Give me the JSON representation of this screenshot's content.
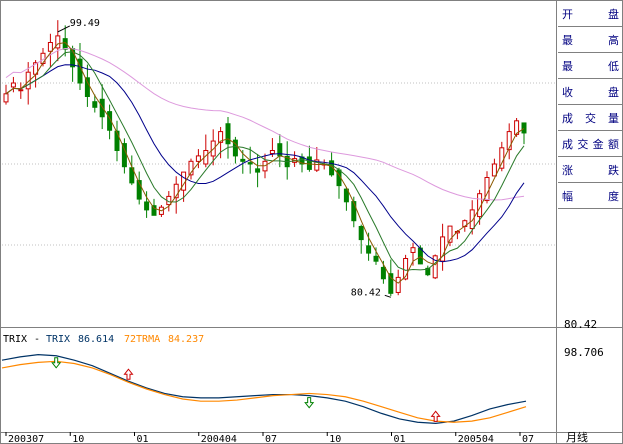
{
  "colors": {
    "background": "#ffffff",
    "up_candle": "#cc0000",
    "down_candle": "#008000",
    "ma_short": "#8b5a00",
    "ma_mid": "#2a7a2a",
    "ma_long": "#00008b",
    "ma_longest": "#dd99dd",
    "trix_line": "#003366",
    "trma_line": "#ff8800",
    "grid": "#c0c0c0",
    "label_blue": "#000080"
  },
  "side_panel": {
    "items": [
      "开盘",
      "最高",
      "最低",
      "收盘",
      "成交量",
      "成交金额",
      "涨跌",
      "幅度"
    ]
  },
  "indicator_header": {
    "name": "TRIX",
    "separator": "-",
    "trix_label": "TRIX",
    "trix_value": "86.614",
    "trma_label": "72TRMA",
    "trma_value": "84.237"
  },
  "price_axis": {
    "bottom_label": "80.42"
  },
  "indicator_axis": {
    "top_label": "98.706"
  },
  "period_label": "月线",
  "chart_data": [
    {
      "type": "candlestick",
      "title": "",
      "x_tick_labels": [
        "200307",
        "10",
        "01",
        "200404",
        "07",
        "10",
        "01",
        "200504",
        "07"
      ],
      "ylim": [
        78,
        102
      ],
      "annotations": {
        "max": {
          "value": 99.49,
          "label": "99.49"
        },
        "min": {
          "value": 80.42,
          "label": "80.42"
        }
      },
      "series": [
        {
          "name": "price",
          "values": [
            95.2,
            96.0,
            95.5,
            96.8,
            97.5,
            98.2,
            99.0,
            99.49,
            98.5,
            97.2,
            96.0,
            95.0,
            94.2,
            93.5,
            92.5,
            91.0,
            89.8,
            88.6,
            87.4,
            86.6,
            86.2,
            86.8,
            87.6,
            88.5,
            89.4,
            90.2,
            90.6,
            91.0,
            91.7,
            92.4,
            91.5,
            90.6,
            90.2,
            90.0,
            89.4,
            90.2,
            91.0,
            90.6,
            89.8,
            90.4,
            90.0,
            89.6,
            90.3,
            90.0,
            89.2,
            88.4,
            87.2,
            85.8,
            84.4,
            83.4,
            82.8,
            81.5,
            80.42,
            81.6,
            83.0,
            83.8,
            82.6,
            81.8,
            83.2,
            84.6,
            85.4,
            85.0,
            85.8,
            86.6,
            87.8,
            89.0,
            90.0,
            91.2,
            92.4,
            93.2,
            92.3
          ]
        }
      ]
    },
    {
      "type": "line",
      "title": "TRIX",
      "series": [
        {
          "name": "TRIX",
          "values": [
            98.2,
            98.5,
            98.7,
            98.6,
            98.2,
            97.7,
            97.0,
            96.3,
            95.7,
            95.2,
            94.9,
            94.8,
            94.8,
            94.9,
            95.0,
            95.1,
            95.1,
            95.0,
            94.8,
            94.5,
            94.0,
            93.4,
            92.9,
            92.6,
            92.5,
            92.7,
            93.2,
            93.8,
            94.2,
            94.5
          ]
        },
        {
          "name": "72TRMA",
          "values": [
            97.5,
            97.8,
            98.0,
            98.1,
            97.9,
            97.5,
            96.9,
            96.2,
            95.6,
            95.1,
            94.7,
            94.5,
            94.5,
            94.6,
            94.8,
            95.0,
            95.1,
            95.2,
            95.1,
            94.9,
            94.5,
            94.0,
            93.5,
            93.0,
            92.7,
            92.6,
            92.7,
            93.0,
            93.5,
            94.0
          ]
        }
      ],
      "signals": {
        "up": [
          7,
          24
        ],
        "down": [
          3,
          17
        ]
      }
    }
  ]
}
